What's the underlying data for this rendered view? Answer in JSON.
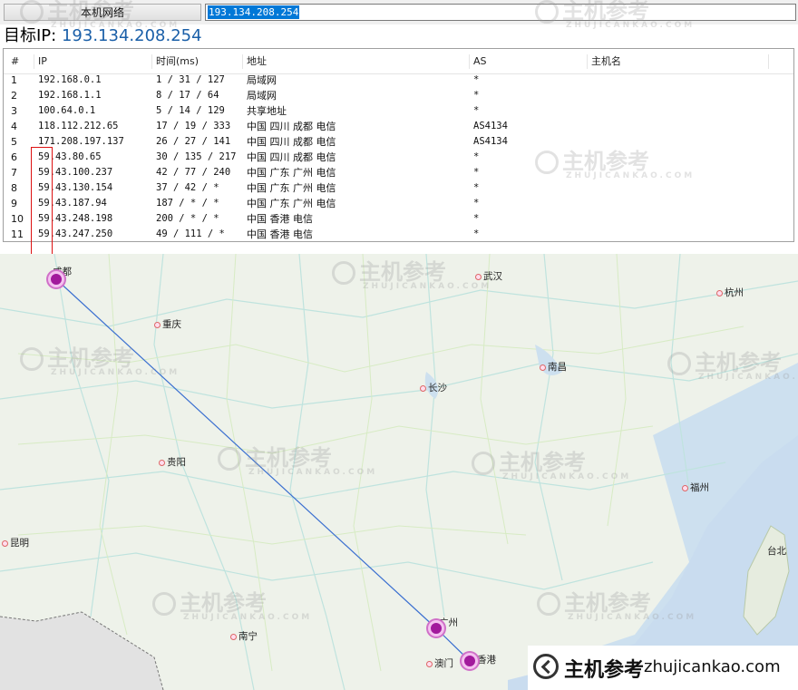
{
  "toolbar": {
    "tab_label": "本机网络",
    "ip_input_value": "193.134.208.254"
  },
  "target": {
    "label": "目标IP:",
    "ip": "193.134.208.254"
  },
  "table": {
    "columns": [
      "#",
      "IP",
      "时间(ms)",
      "地址",
      "AS",
      "主机名"
    ],
    "rows": [
      {
        "n": "1",
        "ip": "192.168.0.1",
        "time": "1 / 31 / 127",
        "addr": "局域网",
        "as": "*",
        "host": ""
      },
      {
        "n": "2",
        "ip": "192.168.1.1",
        "time": "8 / 17 / 64",
        "addr": "局域网",
        "as": "*",
        "host": ""
      },
      {
        "n": "3",
        "ip": "100.64.0.1",
        "time": "5 / 14 / 129",
        "addr": "共享地址",
        "as": "*",
        "host": ""
      },
      {
        "n": "4",
        "ip": "118.112.212.65",
        "time": "17 / 19 / 333",
        "addr": "中国 四川 成都 电信",
        "as": "AS4134",
        "host": ""
      },
      {
        "n": "5",
        "ip": "171.208.197.137",
        "time": "26 / 27 / 141",
        "addr": "中国 四川 成都 电信",
        "as": "AS4134",
        "host": ""
      },
      {
        "n": "6",
        "ip": "59.43.80.65",
        "time": "30 / 135 / 217",
        "addr": "中国 四川 成都 电信",
        "as": "*",
        "host": ""
      },
      {
        "n": "7",
        "ip": "59.43.100.237",
        "time": "42 / 77 / 240",
        "addr": "中国 广东 广州 电信",
        "as": "*",
        "host": ""
      },
      {
        "n": "8",
        "ip": "59.43.130.154",
        "time": "37 / 42 / *",
        "addr": "中国 广东 广州 电信",
        "as": "*",
        "host": ""
      },
      {
        "n": "9",
        "ip": "59.43.187.94",
        "time": "187 / * / *",
        "addr": "中国 广东 广州 电信",
        "as": "*",
        "host": ""
      },
      {
        "n": "10",
        "ip": "59.43.248.198",
        "time": "200 / * / *",
        "addr": "中国 香港 电信",
        "as": "*",
        "host": ""
      },
      {
        "n": "11",
        "ip": "59.43.247.250",
        "time": "49 / 111 / *",
        "addr": "中国 香港 电信",
        "as": "*",
        "host": ""
      }
    ]
  },
  "map": {
    "cities": [
      "成都",
      "重庆",
      "武汉",
      "杭州",
      "南昌",
      "长沙",
      "贵阳",
      "福州",
      "昆明",
      "台北",
      "南宁",
      "广州",
      "澳门",
      "香港"
    ],
    "route_color": "#3a6fd0",
    "node_color": "#a21a9c"
  },
  "watermark": {
    "text": "主机参考",
    "sub": "ZHUJICANKAO.COM"
  },
  "brand": {
    "name": "主机参考",
    "url": "zhujicankao.com"
  }
}
